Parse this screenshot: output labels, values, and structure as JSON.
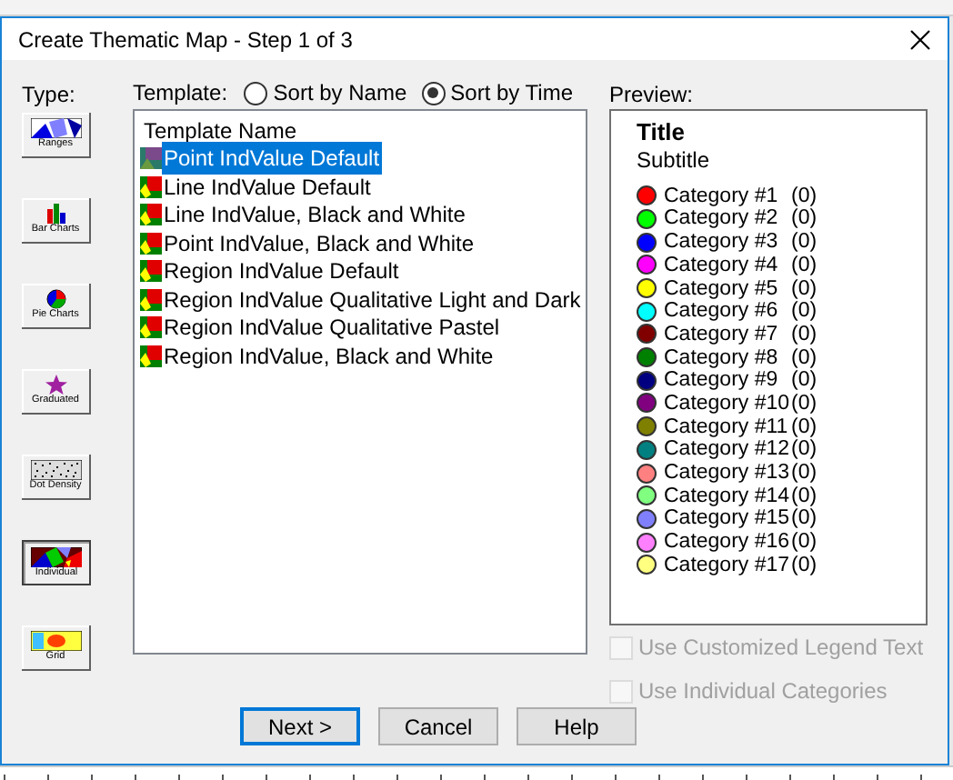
{
  "window": {
    "title": "Create Thematic Map - Step 1 of 3"
  },
  "type_label": "Type:",
  "types": [
    {
      "label": "Ranges",
      "kind": "ranges",
      "selected": false
    },
    {
      "label": "Bar Charts",
      "kind": "bar",
      "selected": false
    },
    {
      "label": "Pie Charts",
      "kind": "pie",
      "selected": false
    },
    {
      "label": "Graduated",
      "kind": "graduated",
      "selected": false
    },
    {
      "label": "Dot Density",
      "kind": "dot",
      "selected": false
    },
    {
      "label": "Individual",
      "kind": "individual",
      "selected": true
    },
    {
      "label": "Grid",
      "kind": "grid",
      "selected": false
    }
  ],
  "template_label": "Template:",
  "sort_options": [
    {
      "label": "Sort by Name",
      "selected": false
    },
    {
      "label": "Sort by Time",
      "selected": true
    }
  ],
  "template_list": {
    "header": "Template Name",
    "items": [
      {
        "label": "Point IndValue Default",
        "kind": "point",
        "selected": true
      },
      {
        "label": "Line IndValue Default",
        "kind": "region",
        "selected": false
      },
      {
        "label": "Line IndValue, Black and White",
        "kind": "region",
        "selected": false
      },
      {
        "label": "Point IndValue, Black and White",
        "kind": "region",
        "selected": false
      },
      {
        "label": "Region IndValue Default",
        "kind": "region",
        "selected": false
      },
      {
        "label": "Region IndValue Qualitative Light and Dark",
        "kind": "region",
        "selected": false
      },
      {
        "label": "Region IndValue Qualitative Pastel",
        "kind": "region",
        "selected": false
      },
      {
        "label": "Region IndValue, Black and White",
        "kind": "region",
        "selected": false
      }
    ]
  },
  "preview_label": "Preview:",
  "preview": {
    "title": "Title",
    "subtitle": "Subtitle",
    "categories": [
      {
        "name": "Category #1",
        "count": "(0)",
        "color": "#ff0000"
      },
      {
        "name": "Category #2",
        "count": "(0)",
        "color": "#00ff00"
      },
      {
        "name": "Category #3",
        "count": "(0)",
        "color": "#0000ff"
      },
      {
        "name": "Category #4",
        "count": "(0)",
        "color": "#ff00ff"
      },
      {
        "name": "Category #5",
        "count": "(0)",
        "color": "#ffff00"
      },
      {
        "name": "Category #6",
        "count": "(0)",
        "color": "#00ffff"
      },
      {
        "name": "Category #7",
        "count": "(0)",
        "color": "#800000"
      },
      {
        "name": "Category #8",
        "count": "(0)",
        "color": "#008000"
      },
      {
        "name": "Category #9",
        "count": "(0)",
        "color": "#000080"
      },
      {
        "name": "Category #10",
        "count": "(0)",
        "color": "#800080"
      },
      {
        "name": "Category #11",
        "count": "(0)",
        "color": "#808000"
      },
      {
        "name": "Category #12",
        "count": "(0)",
        "color": "#008080"
      },
      {
        "name": "Category #13",
        "count": "(0)",
        "color": "#ff8080"
      },
      {
        "name": "Category #14",
        "count": "(0)",
        "color": "#80ff80"
      },
      {
        "name": "Category #15",
        "count": "(0)",
        "color": "#8080ff"
      },
      {
        "name": "Category #16",
        "count": "(0)",
        "color": "#ff80ff"
      },
      {
        "name": "Category #17",
        "count": "(0)",
        "color": "#ffff80"
      }
    ]
  },
  "options": [
    {
      "label": "Use Customized Legend Text",
      "checked": false,
      "disabled": true
    },
    {
      "label": "Use Individual Categories",
      "checked": false,
      "disabled": true
    }
  ],
  "buttons": [
    {
      "label": "Next >",
      "default": true
    },
    {
      "label": "Cancel",
      "default": false
    },
    {
      "label": "Help",
      "default": false
    }
  ]
}
